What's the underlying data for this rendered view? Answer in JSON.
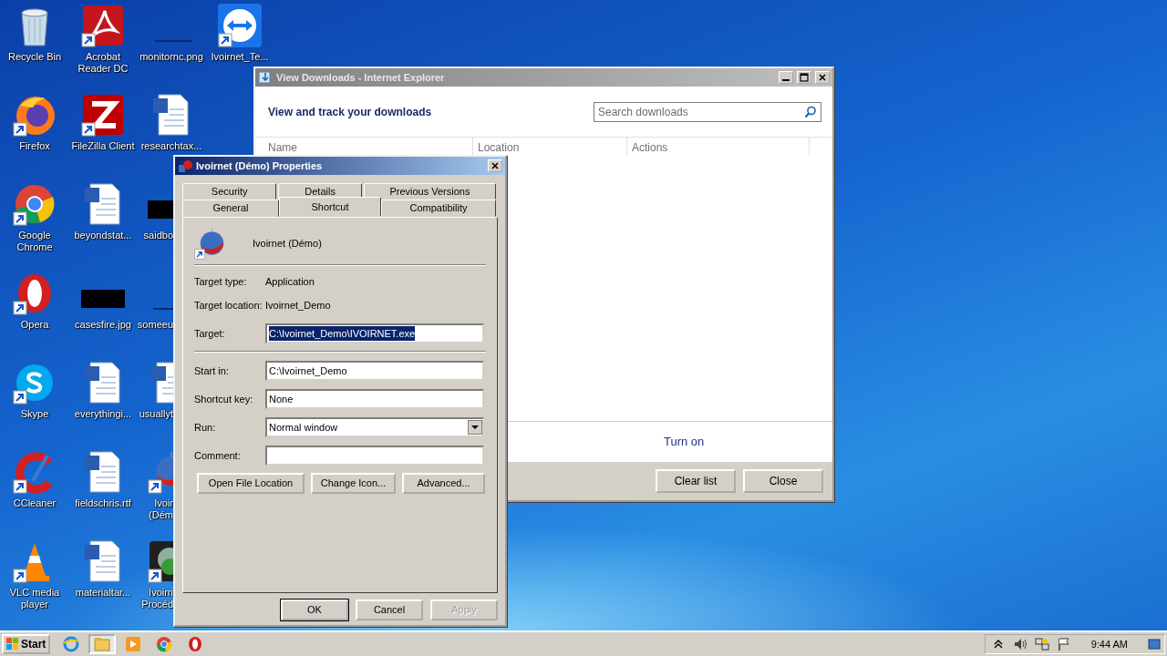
{
  "desktop": {
    "columns": [
      [
        {
          "label": "Recycle Bin",
          "kind": "recycle",
          "shortcut": false,
          "clipped": false
        },
        {
          "label": "Firefox",
          "kind": "firefox",
          "shortcut": true,
          "clipped": false
        },
        {
          "label": "Google\nChrome",
          "kind": "chrome",
          "shortcut": true,
          "clipped": false
        },
        {
          "label": "Opera",
          "kind": "opera",
          "shortcut": true,
          "clipped": false
        },
        {
          "label": "Skype",
          "kind": "skype",
          "shortcut": true,
          "clipped": false
        },
        {
          "label": "CCleaner",
          "kind": "ccleaner",
          "shortcut": true,
          "clipped": false
        },
        {
          "label": "VLC media\nplayer",
          "kind": "vlc",
          "shortcut": true,
          "clipped": false
        }
      ],
      [
        {
          "label": "Acrobat\nReader DC",
          "kind": "acrobat",
          "shortcut": true,
          "clipped": false
        },
        {
          "label": "FileZilla Client",
          "kind": "filezilla",
          "shortcut": true,
          "clipped": false
        },
        {
          "label": "beyondstat...",
          "kind": "word",
          "shortcut": false,
          "clipped": false
        },
        {
          "label": "casesfire.jpg",
          "kind": "black-image",
          "shortcut": false,
          "clipped": false
        },
        {
          "label": "everythingi...",
          "kind": "word",
          "shortcut": false,
          "clipped": false
        },
        {
          "label": "fieldschris.rtf",
          "kind": "word",
          "shortcut": false,
          "clipped": false
        },
        {
          "label": "materialtar...",
          "kind": "word",
          "shortcut": false,
          "clipped": false
        }
      ],
      [
        {
          "label": "monitornc.png",
          "kind": "blank-image",
          "shortcut": false,
          "clipped": false
        },
        {
          "label": "researchtax...",
          "kind": "word",
          "shortcut": false,
          "clipped": false
        },
        {
          "label": "saidbo",
          "kind": "black-image",
          "shortcut": false,
          "clipped": true
        },
        {
          "label": "someeu",
          "kind": "blank-image",
          "shortcut": false,
          "clipped": true
        },
        {
          "label": "usuallyt",
          "kind": "word",
          "shortcut": false,
          "clipped": true
        },
        {
          "label": "Ivoir\n(Dém",
          "kind": "globe",
          "shortcut": true,
          "clipped": true
        },
        {
          "label": "Ivoirn\nProcéd",
          "kind": "dark-app",
          "shortcut": true,
          "clipped": true
        }
      ],
      [
        {
          "label": "Ivoirnet_Te...",
          "kind": "teamviewer",
          "shortcut": true,
          "clipped": false
        }
      ]
    ]
  },
  "downloads_window": {
    "title": "View Downloads - Internet Explorer",
    "active": false,
    "heading": "View and track your downloads",
    "search": {
      "placeholder": "Search downloads"
    },
    "columns": [
      "Name",
      "Location",
      "Actions"
    ],
    "link": "Turn on",
    "buttons": [
      "Clear list",
      "Close"
    ]
  },
  "properties_dialog": {
    "title": "Ivoirnet (Démo) Properties",
    "active": true,
    "tab_rows": [
      [
        {
          "label": "Security",
          "selected": false
        },
        {
          "label": "Details",
          "selected": false
        },
        {
          "label": "Previous Versions",
          "selected": false
        }
      ],
      [
        {
          "label": "General",
          "selected": false
        },
        {
          "label": "Shortcut",
          "selected": true
        },
        {
          "label": "Compatibility",
          "selected": false
        }
      ]
    ],
    "item_name": "Ivoirnet (Démo)",
    "fields": [
      {
        "kind": "text",
        "label": "Target type:",
        "value": "Application"
      },
      {
        "kind": "text",
        "label": "Target location:",
        "value": "Ivoirnet_Demo"
      },
      {
        "kind": "input",
        "label": "Target:",
        "value": "C:\\Ivoirnet_Demo\\IVOIRNET.exe",
        "selected": true
      },
      {
        "kind": "separator"
      },
      {
        "kind": "input",
        "label": "Start in:",
        "value": "C:\\Ivoirnet_Demo",
        "selected": false
      },
      {
        "kind": "input",
        "label": "Shortcut key:",
        "value": "None",
        "selected": false
      },
      {
        "kind": "select",
        "label": "Run:",
        "value": "Normal window"
      },
      {
        "kind": "input",
        "label": "Comment:"
      }
    ],
    "actions": [
      "Open File Location",
      "Change Icon...",
      "Advanced..."
    ],
    "buttons": [
      {
        "label": "OK",
        "default": true,
        "disabled": false
      },
      {
        "label": "Cancel",
        "default": false,
        "disabled": false
      },
      {
        "label": "Apply",
        "default": false,
        "disabled": true
      }
    ]
  },
  "taskbar": {
    "start": "Start",
    "apps": [
      {
        "kind": "ie",
        "pressed": false
      },
      {
        "kind": "explorer",
        "pressed": true
      },
      {
        "kind": "media",
        "pressed": false
      },
      {
        "kind": "chrome",
        "pressed": false
      },
      {
        "kind": "opera",
        "pressed": false
      }
    ],
    "tray": [
      {
        "kind": "arrow"
      },
      {
        "kind": "volume"
      },
      {
        "kind": "network"
      },
      {
        "kind": "flag"
      }
    ],
    "clock": "9:44 AM"
  }
}
